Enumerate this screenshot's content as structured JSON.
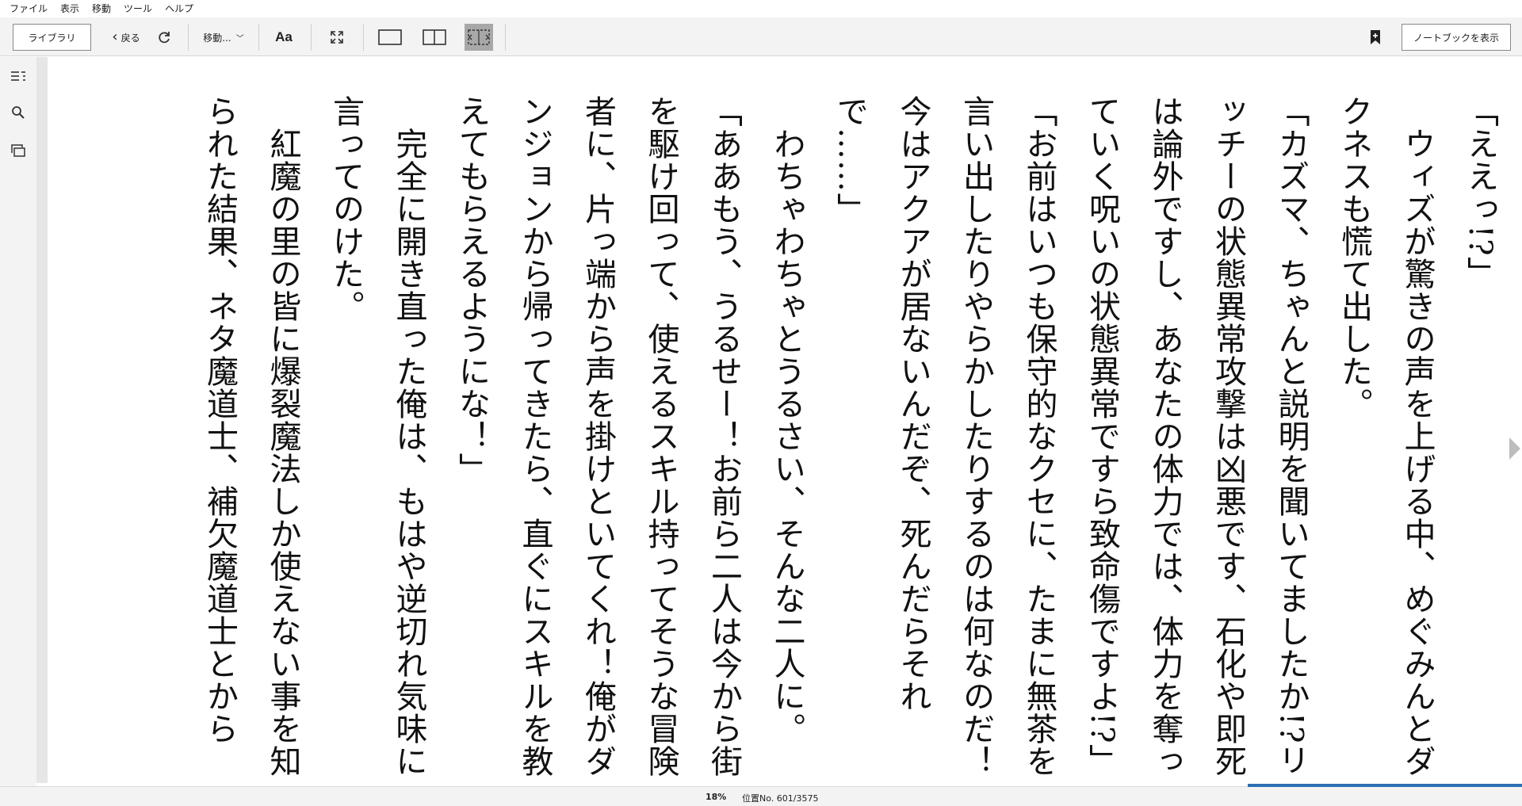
{
  "menubar": {
    "items": [
      "ファイル",
      "表示",
      "移動",
      "ツール",
      "ヘルプ"
    ]
  },
  "toolbar": {
    "library_label": "ライブラリ",
    "back_label": "戻る",
    "goto_label": "移動...",
    "font_label": "Aa",
    "notebook_label": "ノートブックを表示"
  },
  "icons": {
    "refresh": "refresh-icon",
    "fullscreen": "fullscreen-icon",
    "single_page": "single-page-icon",
    "two_page": "two-page-icon",
    "fit_width": "fit-width-icon",
    "bookmark": "bookmark-icon",
    "toc": "toc-icon",
    "search": "search-icon",
    "flashcards": "flashcards-icon"
  },
  "colors": {
    "progress": "#2c6fb2",
    "active_button": "#a8a8a8"
  },
  "page": {
    "paragraphs": [
      "「ええっ!?」",
      "　ウィズが驚きの声を上げる中、めぐみんとダクネスも慌て出した。",
      "「カズマ、ちゃんと説明を聞いてましたか!?リッチーの状態異常攻撃は凶悪です、石化や即死は論外ですし、あなたの体力では、体力を奪っていく呪いの状態異常ですら致命傷ですよ!?」",
      "「お前はいつも保守的なクセに、たまに無茶を言い出したりやらかしたりするのは何なのだ！今はアクアが居ないんだぞ、死んだらそれで……」",
      "　わちゃわちゃとうるさい、そんな二人に。",
      "「ああもう、うるせー！お前ら二人は今から街を駆け回って、使えるスキル持ってそうな冒険者に、片っ端から声を掛けといてくれ！俺がダンジョンから帰ってきたら、直ぐにスキルを教えてもらえるようにな！」",
      "　完全に開き直った俺は、もはや逆切れ気味に言ってのけた。",
      "　紅魔の里の皆に爆裂魔法しか使えない事を知られた結果、ネタ魔道士、補欠魔道士とから"
    ]
  },
  "status": {
    "percent_label": "18%",
    "percent_value": 18,
    "location_label": "位置No. 601/3575"
  }
}
